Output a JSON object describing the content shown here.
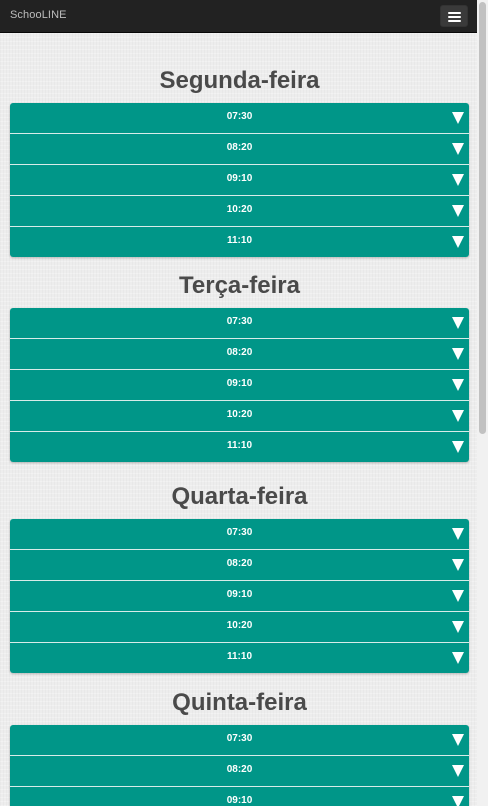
{
  "navbar": {
    "brand": "SchooLINE",
    "menu_icon": "hamburger-menu-icon"
  },
  "days": [
    {
      "name": "Segunda-feira",
      "slots": [
        "07:30",
        "08:20",
        "09:10",
        "10:20",
        "11:10"
      ]
    },
    {
      "name": "Terça-feira",
      "slots": [
        "07:30",
        "08:20",
        "09:10",
        "10:20",
        "11:10"
      ]
    },
    {
      "name": "Quarta-feira",
      "slots": [
        "07:30",
        "08:20",
        "09:10",
        "10:20",
        "11:10"
      ]
    },
    {
      "name": "Quinta-feira",
      "slots": [
        "07:30",
        "08:20",
        "09:10"
      ]
    }
  ],
  "slot_expand_icon": "triangle-down-icon",
  "colors": {
    "navbar": "#222222",
    "slot": "#009688",
    "title": "#4a4a4a"
  }
}
